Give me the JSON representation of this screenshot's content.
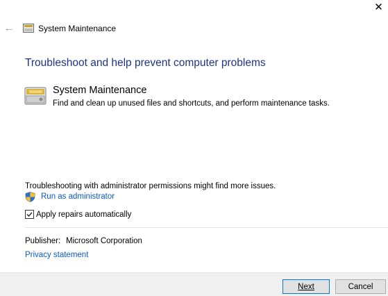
{
  "window": {
    "title": "System Maintenance",
    "close_glyph": "✕",
    "back_glyph": "←"
  },
  "main": {
    "heading": "Troubleshoot and help prevent computer problems",
    "item": {
      "title": "System Maintenance",
      "description": "Find and clean up unused files and shortcuts, and perform maintenance tasks.",
      "icon": "system-maintenance-icon"
    },
    "admin_note": "Troubleshooting with administrator permissions might find more issues.",
    "run_as_admin": "Run as administrator",
    "apply_repairs": {
      "label": "Apply repairs automatically",
      "checked": true
    },
    "publisher": {
      "label": "Publisher:",
      "value": "Microsoft Corporation"
    },
    "privacy_statement": "Privacy statement"
  },
  "footer": {
    "next_label": "Next",
    "cancel_label": "Cancel"
  },
  "colors": {
    "heading": "#1e3287",
    "link": "#0b59c4",
    "footer_bg": "#f0f0f0",
    "default_button_border": "#0078d7"
  }
}
